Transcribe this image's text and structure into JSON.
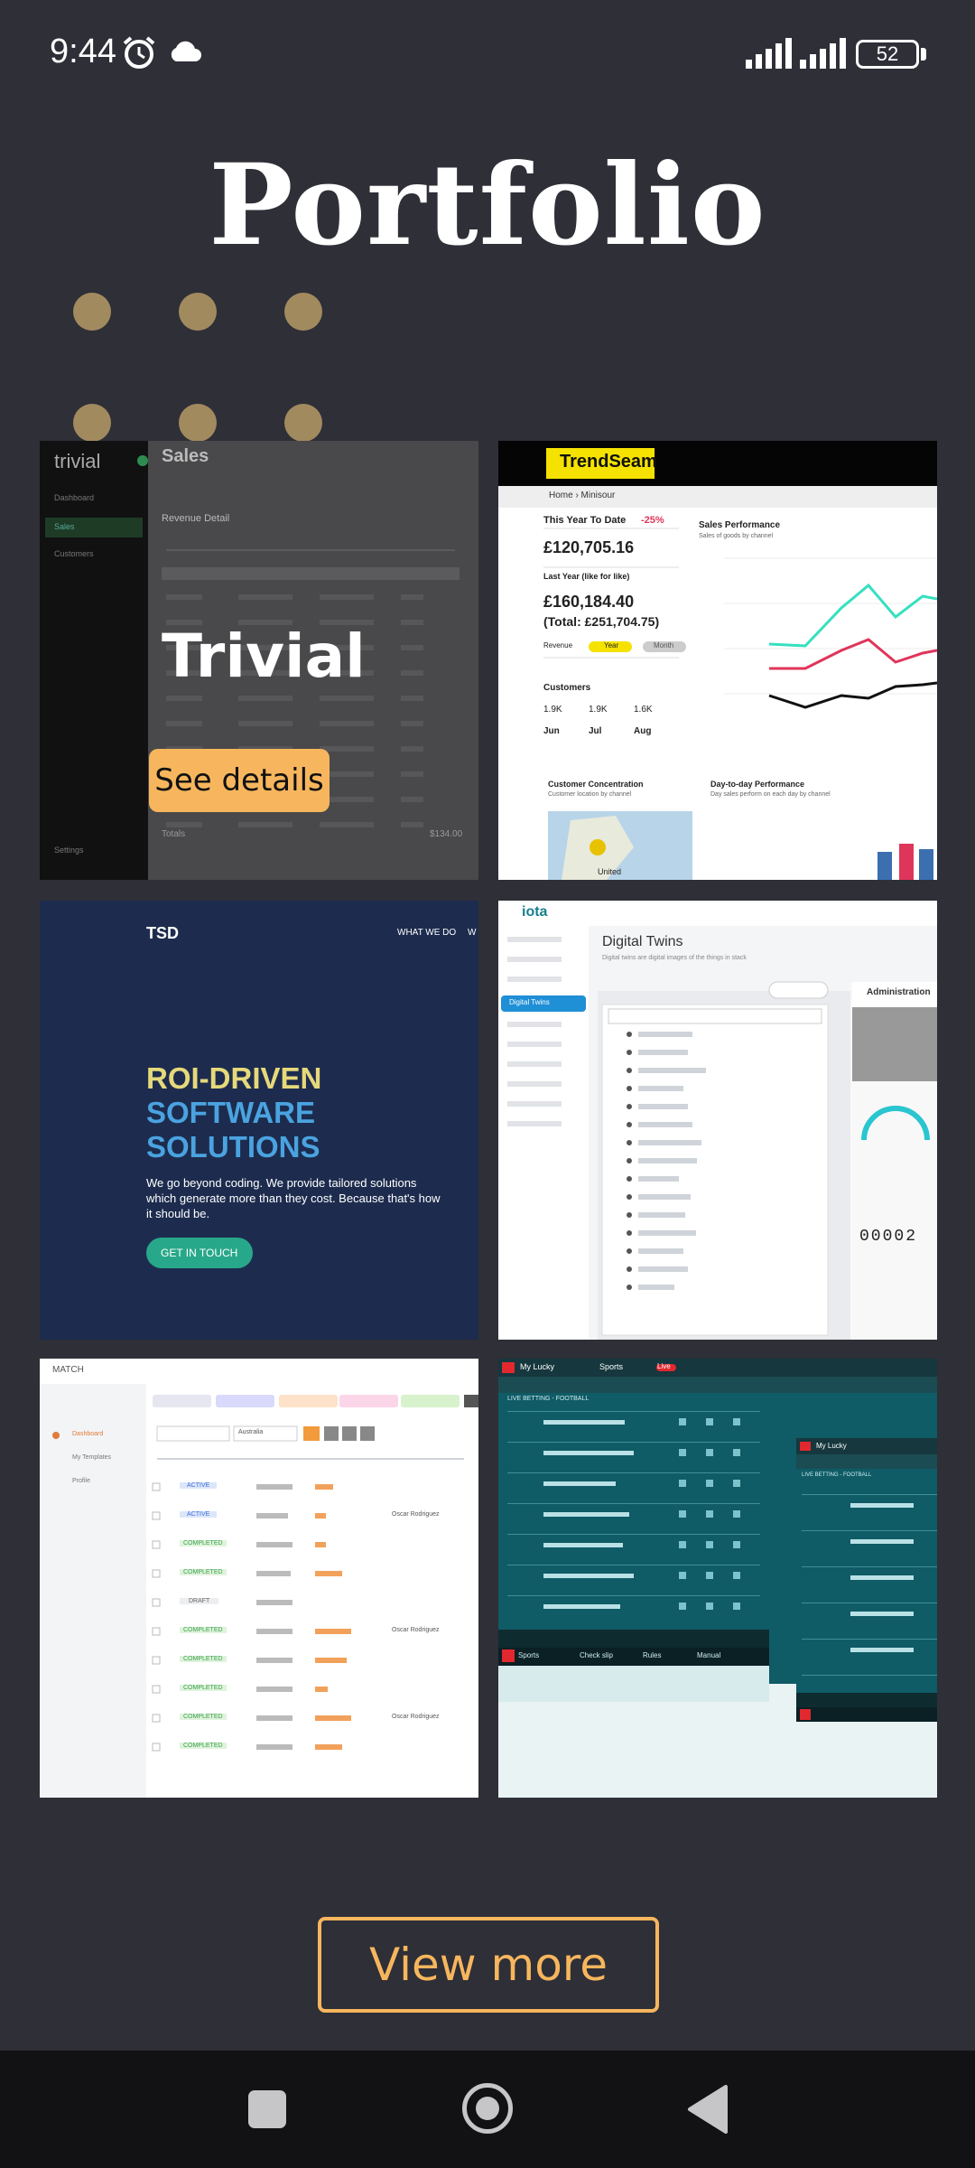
{
  "status_bar": {
    "time": "9:44",
    "battery": "52",
    "icons": [
      "alarm-icon",
      "cloud-icon",
      "signal-icon",
      "signal-icon",
      "battery-icon"
    ]
  },
  "page": {
    "title": "Portfolio",
    "accent_color": "#f7b65d",
    "background_color": "#2e2f37"
  },
  "tiles": [
    {
      "name": "Trivial",
      "button": "See details",
      "shot": {
        "logo": "trivial",
        "heading": "Sales",
        "sub": "Revenue Detail",
        "nav": [
          "Dashboard",
          "Sales",
          "Customers"
        ],
        "foot": "Settings",
        "total_label": "Totals",
        "total_value": "$134.00"
      }
    },
    {
      "shot": {
        "brand": "TrendSeam",
        "crumb": "Home › Minisour",
        "ytd_label": "This Year To Date",
        "ytd_pct": "-25%",
        "ytd_value": "£120,705.16",
        "last_label": "Last Year (like for like)",
        "last_value": "£160,184.40",
        "last_total": "(Total: £251,704.75)",
        "revenue": "Revenue",
        "year_btn": "Year",
        "month_btn": "Month",
        "customers": "Customers",
        "cust_values": [
          "1.9K",
          "1.9K",
          "1.6K"
        ],
        "months": [
          "Jun",
          "Jul",
          "Aug"
        ],
        "chart_title": "Sales Performance",
        "chart_sub": "Sales of goods by channel",
        "conc_title": "Customer Concentration",
        "conc_sub": "Customer location by channel",
        "day_title": "Day-to-day Performance",
        "day_sub": "Day sales perform on each day by channel",
        "map_label": "United"
      }
    },
    {
      "shot": {
        "logo": "TSD",
        "nav": [
          "WHAT WE DO",
          "W"
        ],
        "line1": "ROI-DRIVEN",
        "line2": "SOFTWARE",
        "line3": "SOLUTIONS",
        "body1": "We go beyond coding. We provide tailored solutions",
        "body2": "which generate more than they cost. Because that's how",
        "body3": "it should be.",
        "cta": "GET IN TOUCH"
      }
    },
    {
      "shot": {
        "logo": "iota",
        "title": "Digital Twins",
        "sub": "Digital twins are digital images of the things in stack",
        "active_nav": "Digital Twins",
        "panel_title": "Administration",
        "counter": "00002"
      }
    },
    {
      "shot": {
        "logo": "MATCH",
        "nav": [
          "Dashboard",
          "My Templates",
          "Profile"
        ],
        "filter": "Australia",
        "statuses": [
          "ACTIVE",
          "ACTIVE",
          "COMPLETED",
          "COMPLETED",
          "DRAFT",
          "COMPLETED",
          "COMPLETED",
          "COMPLETED",
          "COMPLETED",
          "COMPLETED"
        ],
        "owner": "Oscar Rodriguez"
      }
    },
    {
      "shot": {
        "brand": "My Lucky",
        "tabs": [
          "Sports",
          "Live"
        ],
        "title": "LIVE BETTING - FOOTBALL",
        "bottom": [
          "Sports",
          "Check slip",
          "Rules",
          "Manual"
        ]
      }
    }
  ],
  "cta": {
    "view_more": "View more"
  }
}
